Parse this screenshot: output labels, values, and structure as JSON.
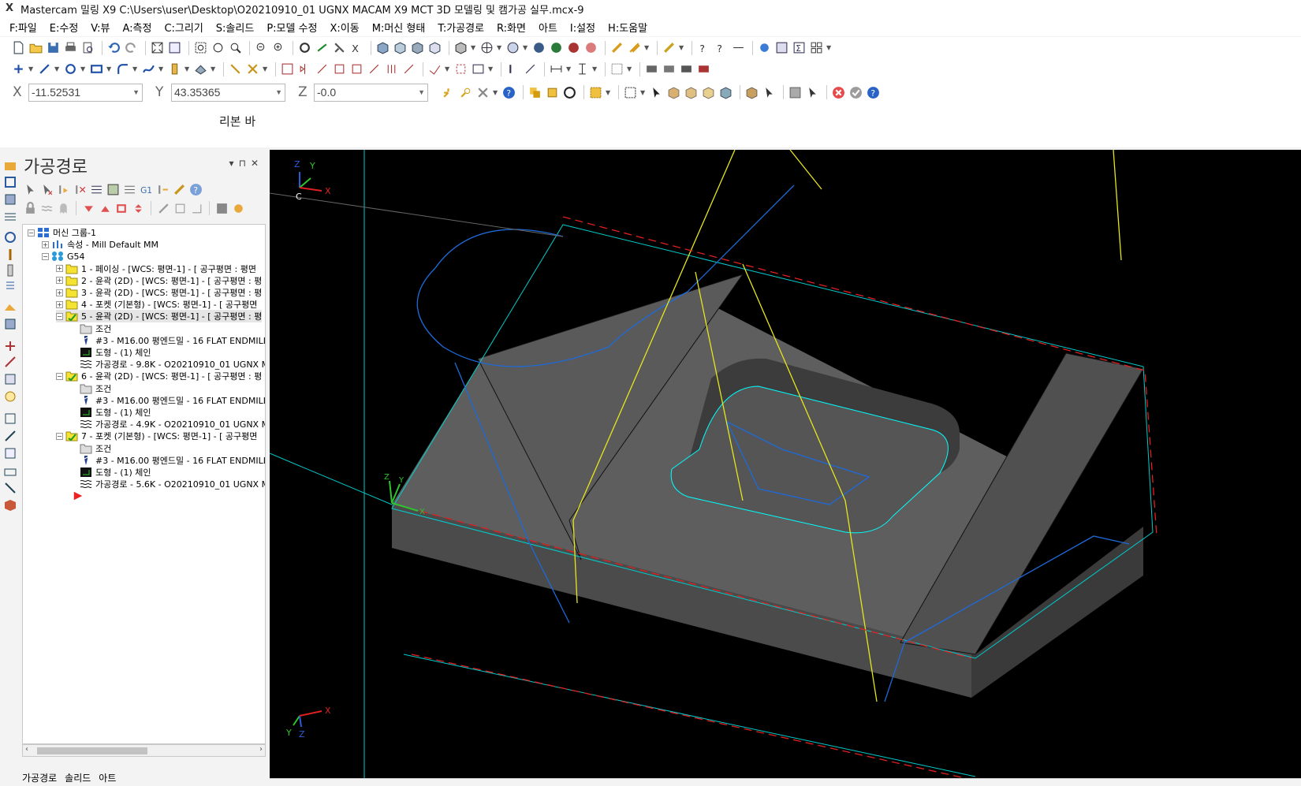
{
  "window": {
    "title": "Mastercam 밀링 X9  C:\\Users\\user\\Desktop\\O20210910_01 UGNX MACAM X9 MCT 3D 모델링 및 캠가공 실무.mcx-9"
  },
  "menu": [
    "F:파일",
    "E:수정",
    "V:뷰",
    "A:측정",
    "C:그리기",
    "S:솔리드",
    "P:모델 수정",
    "X:이동",
    "M:머신 형태",
    "T:가공경로",
    "R:화면",
    "아트",
    "I:설정",
    "H:도움말"
  ],
  "coords": {
    "x_label": "X",
    "x_value": "-11.52531",
    "y_label": "Y",
    "y_value": "43.35365",
    "z_label": "Z",
    "z_value": "-0.0"
  },
  "ribbon": {
    "label": "리본 바"
  },
  "panel": {
    "title": "가공경로",
    "tabs": [
      "가공경로",
      "솔리드",
      "아트"
    ]
  },
  "tree": [
    {
      "text": "머신 그룹-1",
      "indent": 0,
      "icon": "machine-group-icon",
      "exp": "−"
    },
    {
      "text": "속성 - Mill Default MM",
      "indent": 1,
      "icon": "properties-icon",
      "exp": "+"
    },
    {
      "text": "G54",
      "indent": 1,
      "icon": "toolpath-group-icon",
      "exp": "−"
    },
    {
      "text": "1 - 페이싱 - [WCS: 평면-1] - [  공구평면 : 평면",
      "indent": 2,
      "icon": "folder-icon",
      "exp": "+"
    },
    {
      "text": "2 - 윤곽 (2D) - [WCS: 평면-1] - [  공구평면 : 평",
      "indent": 2,
      "icon": "folder-icon",
      "exp": "+"
    },
    {
      "text": "3 - 윤곽 (2D) - [WCS: 평면-1] - [  공구평면 : 평",
      "indent": 2,
      "icon": "folder-icon",
      "exp": "+"
    },
    {
      "text": "4 - 포켓 (기본형) - [WCS: 평면-1] - [  공구평면",
      "indent": 2,
      "icon": "folder-icon",
      "exp": "+"
    },
    {
      "text": "5 - 윤곽 (2D) - [WCS: 평면-1] - [  공구평면 : 평",
      "indent": 2,
      "icon": "folder-open-icon",
      "exp": "−",
      "selected": true
    },
    {
      "text": "조건",
      "indent": 3,
      "icon": "parameters-icon"
    },
    {
      "text": "#3 - M16.00 평엔드밀 - 16 FLAT ENDMILL",
      "indent": 3,
      "icon": "tool-icon"
    },
    {
      "text": "도형 - (1) 체인",
      "indent": 3,
      "icon": "geometry-icon"
    },
    {
      "text": "가공경로 - 9.8K - O20210910_01 UGNX MA",
      "indent": 3,
      "icon": "toolpath-icon"
    },
    {
      "text": "6 - 윤곽 (2D) - [WCS: 평면-1] - [  공구평면 : 평",
      "indent": 2,
      "icon": "folder-open-icon",
      "exp": "−"
    },
    {
      "text": "조건",
      "indent": 3,
      "icon": "parameters-icon"
    },
    {
      "text": "#3 - M16.00 평엔드밀 - 16 FLAT ENDMILL",
      "indent": 3,
      "icon": "tool-icon"
    },
    {
      "text": "도형 - (1) 체인",
      "indent": 3,
      "icon": "geometry-icon"
    },
    {
      "text": "가공경로 - 4.9K - O20210910_01 UGNX MA",
      "indent": 3,
      "icon": "toolpath-icon"
    },
    {
      "text": "7 - 포켓 (기본형) - [WCS: 평면-1] - [  공구평면",
      "indent": 2,
      "icon": "folder-open-icon",
      "exp": "−"
    },
    {
      "text": "조건",
      "indent": 3,
      "icon": "parameters-icon"
    },
    {
      "text": "#3 - M16.00 평엔드밀 - 16 FLAT ENDMILL",
      "indent": 3,
      "icon": "tool-icon"
    },
    {
      "text": "도형 - (1) 체인",
      "indent": 3,
      "icon": "geometry-icon"
    },
    {
      "text": "가공경로 - 5.6K - O20210910_01 UGNX MA",
      "indent": 3,
      "icon": "toolpath-icon"
    }
  ],
  "viewport": {
    "gnomon_top": {
      "z": "Z",
      "y": "Y",
      "c": "C",
      "x": "X"
    },
    "gnomon_part": {
      "z": "Z",
      "y": "Y",
      "x": "X"
    },
    "gnomon_bottom": {
      "y": "Y",
      "z": "Z",
      "x": "X"
    }
  }
}
